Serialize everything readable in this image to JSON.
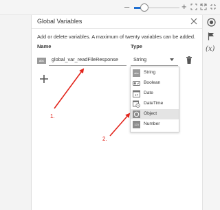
{
  "toolbar": {
    "zoom_minus": "–",
    "zoom_plus": "+",
    "zoom_level": 0.22,
    "accent_color": "#1f6fd1"
  },
  "dialog": {
    "title": "Global Variables",
    "description": "Add or delete variables. A maximum of twenty variables can be added.",
    "columns": {
      "name": "Name",
      "type": "Type"
    },
    "rows": [
      {
        "type_icon": "abc",
        "name_value": "global_var_readFileResponse",
        "type_value": "String"
      }
    ]
  },
  "type_menu": {
    "items": [
      {
        "label": "String",
        "icon": "string-icon"
      },
      {
        "label": "Boolean",
        "icon": "boolean-icon"
      },
      {
        "label": "Date",
        "icon": "date-icon",
        "icon_text": "17"
      },
      {
        "label": "DateTime",
        "icon": "datetime-icon"
      },
      {
        "label": "Object",
        "icon": "object-icon",
        "selected": true
      },
      {
        "label": "Number",
        "icon": "number-icon",
        "icon_text": "123"
      }
    ]
  },
  "right_rail": {
    "variables_icon_text": "(x)"
  },
  "annotations": {
    "label_1": "1.",
    "label_2": "2.",
    "color": "#e2231a"
  }
}
